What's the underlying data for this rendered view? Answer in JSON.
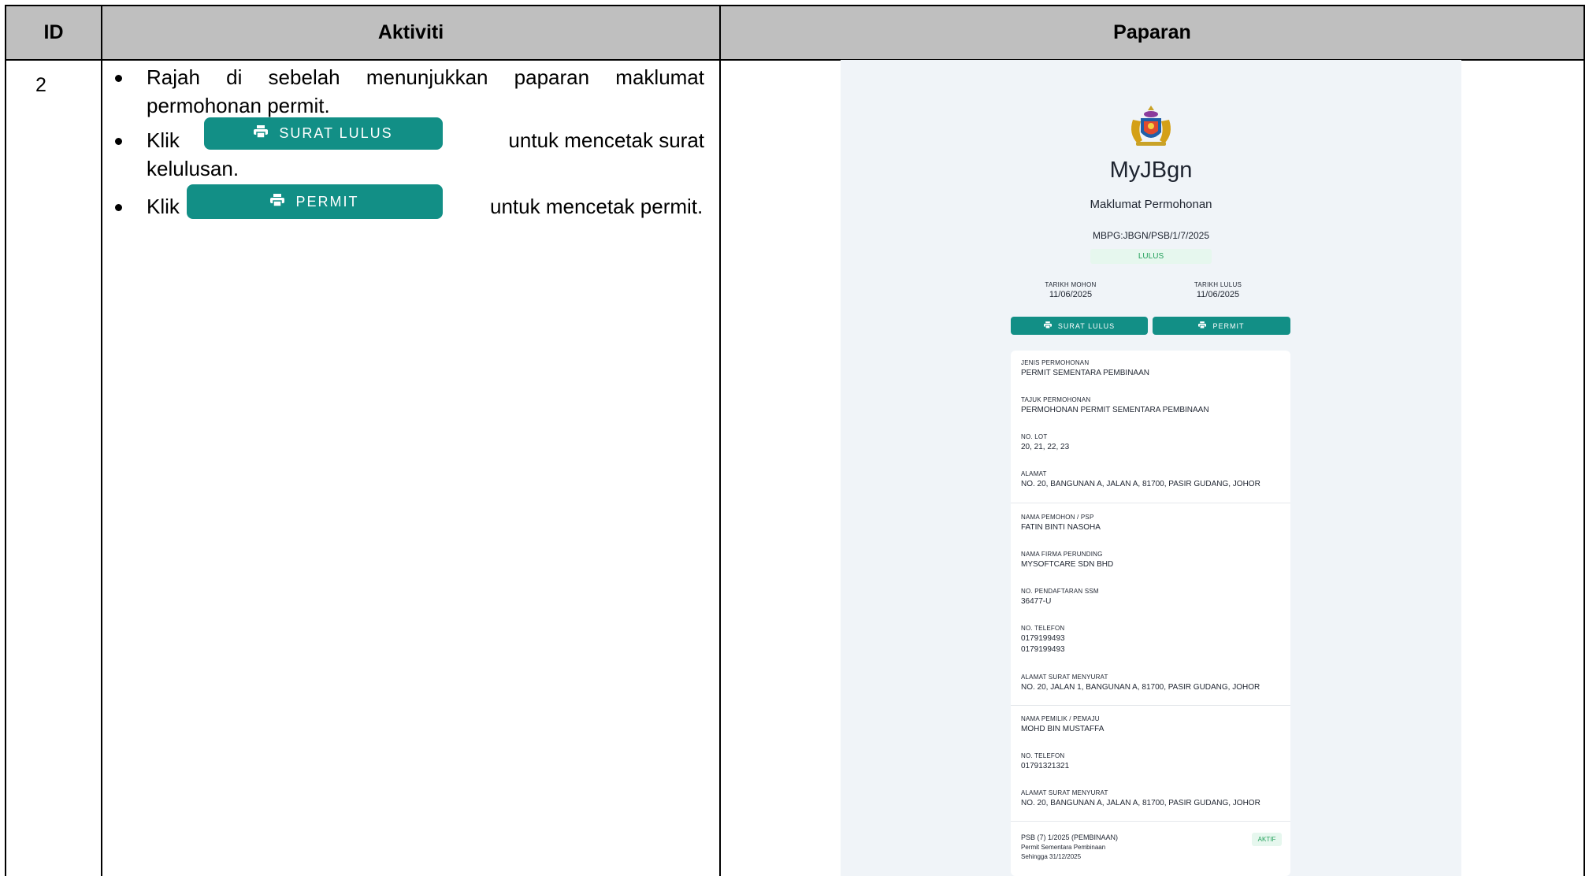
{
  "table": {
    "headers": {
      "id": "ID",
      "aktiviti": "Aktiviti",
      "paparan": "Paparan"
    },
    "row": {
      "id": "2",
      "bullet1": "Rajah di sebelah menunjukkan paparan maklumat",
      "bullet1_cont": "permohonan permit.",
      "bullet2_pre": "Klik",
      "bullet2_post": "untuk mencetak surat",
      "bullet2_cont": "kelulusan.",
      "bullet3_pre": "Klik",
      "bullet3_post": "untuk mencetak permit.",
      "btn_surat": "SURAT LULUS",
      "btn_permit": "PERMIT"
    }
  },
  "screenshot": {
    "brand": "MyJBgn",
    "subtitle": "Maklumat Permohonan",
    "ref": "MBPG:JBGN/PSB/1/7/2025",
    "status": "LULUS",
    "tarikh_mohon_label": "TARIKH MOHON",
    "tarikh_mohon": "11/06/2025",
    "tarikh_lulus_label": "TARIKH LULUS",
    "tarikh_lulus": "11/06/2025",
    "btn_surat": "SURAT LULUS",
    "btn_permit": "PERMIT",
    "fields": [
      {
        "label": "JENIS PERMOHONAN",
        "value": "PERMIT SEMENTARA PEMBINAAN"
      },
      {
        "label": "TAJUK PERMOHONAN",
        "value": "PERMOHONAN PERMIT SEMENTARA PEMBINAAN"
      },
      {
        "label": "NO. LOT",
        "value": "20, 21, 22, 23"
      },
      {
        "label": "ALAMAT",
        "value": "NO. 20, BANGUNAN A, JALAN A, 81700, PASIR GUDANG, JOHOR"
      },
      {
        "label": "NAMA PEMOHON / PSP",
        "value": "FATIN BINTI NASOHA"
      },
      {
        "label": "NAMA FIRMA PERUNDING",
        "value": "MYSOFTCARE SDN BHD"
      },
      {
        "label": "NO. PENDAFTARAN SSM",
        "value": "36477-U"
      },
      {
        "label": "NO. TELEFON",
        "value": "0179199493",
        "value2": "0179199493"
      },
      {
        "label": "ALAMAT SURAT MENYURAT",
        "value": "NO. 20, JALAN 1, BANGUNAN A, 81700, PASIR GUDANG, JOHOR"
      },
      {
        "label": "NAMA PEMILIK / PEMAJU",
        "value": "MOHD BIN MUSTAFFA"
      },
      {
        "label": "NO. TELEFON",
        "value": "01791321321"
      },
      {
        "label": "ALAMAT SURAT MENYURAT",
        "value": "NO. 20, BANGUNAN A, JALAN A, 81700, PASIR GUDANG, JOHOR"
      }
    ],
    "permit": {
      "code": "PSB (7) 1/2025 (PEMBINAAN)",
      "type": "Permit Sementara Pembinaan",
      "until": "Sehingga 31/12/2025",
      "badge": "AKTIF"
    }
  }
}
